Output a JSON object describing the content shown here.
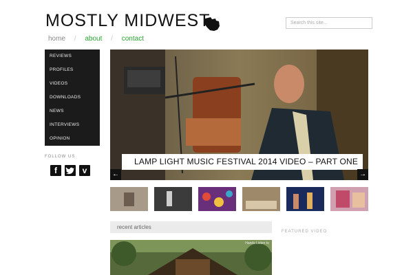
{
  "header": {
    "site_title": "MOSTLY MIDWEST",
    "search_placeholder": "Search this site..."
  },
  "topnav": {
    "home": "home",
    "about": "about",
    "contact": "contact",
    "separator": "/"
  },
  "sidebar": {
    "items": [
      "REVIEWS",
      "PROFILES",
      "VIDEOS",
      "DOWNLOADS",
      "NEWS",
      "INTERVIEWS",
      "OPINION"
    ]
  },
  "follow": {
    "label": "FOLLOW US",
    "icons": [
      "facebook-icon",
      "twitter-icon",
      "vimeo-icon"
    ]
  },
  "hero": {
    "caption": "LAMP LIGHT MUSIC FESTIVAL 2014 VIDEO – PART ONE",
    "prev": "←",
    "next": "→"
  },
  "sections": {
    "recent": "recent articles",
    "featured": "FEATURED VIDEO"
  },
  "article": {
    "tag": "Hands Listen to"
  },
  "colors": {
    "accent_green": "#2aa332",
    "sidebar_bg": "#1b1b1b"
  }
}
